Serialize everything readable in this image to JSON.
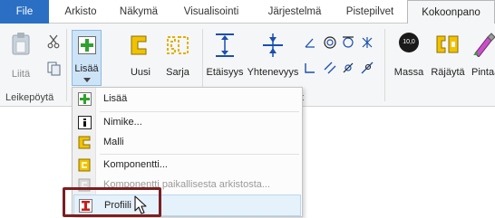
{
  "tabs": [
    {
      "label": "File"
    },
    {
      "label": "Arkisto"
    },
    {
      "label": "Näkymä"
    },
    {
      "label": "Visualisointi"
    },
    {
      "label": "Järjestelmä"
    },
    {
      "label": "Pistepilvet"
    },
    {
      "label": "Kokoonpano"
    }
  ],
  "ribbon": {
    "clipboard": {
      "paste_label": "Liitä",
      "group_label": "Leikepöytä"
    },
    "insert": {
      "add_label": "Lisää",
      "new_label": "Uusi",
      "series_label": "Sarja"
    },
    "dimensions": {
      "distance_label": "Etäisyys",
      "coincident_label": "Yhtenevyys",
      "group_label_visible": "t"
    },
    "other": {
      "mass_label": "Massa",
      "explode_label": "Räjäytä",
      "paint_label": "Pintaa",
      "mass_icon_text": "10,0"
    }
  },
  "menu": {
    "items": [
      {
        "label": "Lisää",
        "icon": "green-plus-icon",
        "enabled": true
      },
      {
        "label": "Nimike...",
        "icon": "info-icon",
        "enabled": true
      },
      {
        "label": "Malli",
        "icon": "yellow-part-icon",
        "enabled": true
      },
      {
        "label": "Komponentti...",
        "icon": "yellow-component-icon",
        "enabled": true
      },
      {
        "label": "Komponentti paikallisesta arkistosta...",
        "icon": "component-archive-icon",
        "enabled": false
      },
      {
        "label": "Profiili",
        "icon": "red-profile-icon",
        "enabled": true
      }
    ]
  },
  "colors": {
    "file_tab": "#2b6fc4",
    "highlight": "#7a1f22",
    "accent_yellow": "#f2c200",
    "accent_green": "#2fa12f"
  }
}
